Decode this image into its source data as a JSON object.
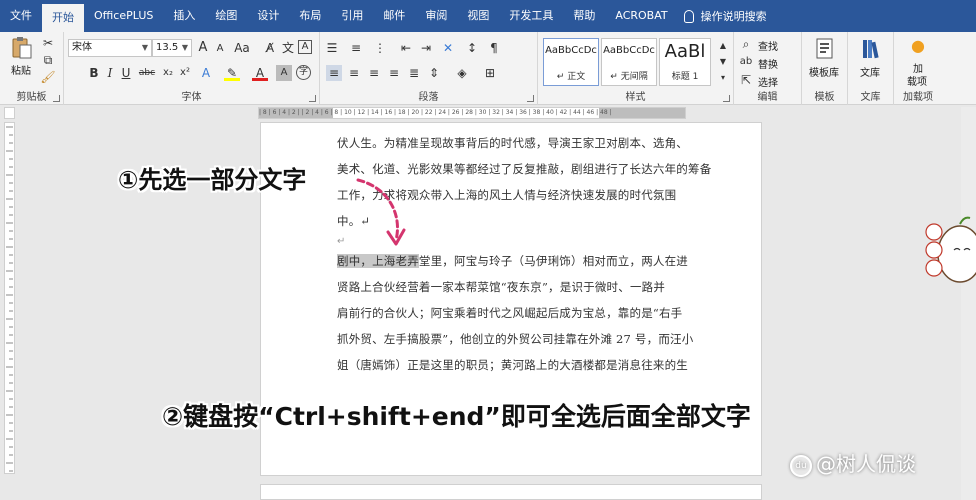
{
  "tabs": [
    "文件",
    "开始",
    "OfficePLUS",
    "插入",
    "绘图",
    "设计",
    "布局",
    "引用",
    "邮件",
    "审阅",
    "视图",
    "开发工具",
    "帮助",
    "ACROBAT"
  ],
  "active_tab_index": 1,
  "tell_me": "操作说明搜索",
  "ribbon": {
    "clipboard": {
      "paste": "粘贴",
      "label": "剪贴板"
    },
    "font": {
      "name": "宋体",
      "size": "13.5",
      "label": "字体",
      "bold": "B",
      "italic": "I",
      "underline": "U",
      "strike": "abc",
      "sub": "x₂",
      "sup": "x²",
      "grow": "A",
      "shrink": "A",
      "case": "Aa"
    },
    "paragraph": {
      "label": "段落"
    },
    "styles": {
      "label": "样式",
      "items": [
        {
          "sample": "AaBbCcDc",
          "name": "↵ 正文"
        },
        {
          "sample": "AaBbCcDc",
          "name": "↵ 无间隔"
        },
        {
          "sample": "AaBl",
          "name": "标题 1"
        }
      ]
    },
    "editing": {
      "find": "查找",
      "replace": "替换",
      "select": "选择",
      "label": "编辑"
    },
    "template": {
      "btn": "模板库",
      "label": "模板"
    },
    "library": {
      "btn": "文库",
      "label": "文库"
    },
    "addins": {
      "btn_line1": "加",
      "btn_line2": "载项",
      "label": "加载项"
    }
  },
  "ruler_marks": "| 8 | 6 | 4 | 2 |  | 2 | 4 | 6 | 8 | 10 | 12 | 14 | 16 | 18 | 20 | 22 | 24 | 26 | 28 | 30 | 32 | 34 | 36 | 38 | 40 | 42 | 44 | 46 | 48 |",
  "document": {
    "lines": [
      "伏人生。为精准呈现故事背后的时代感，导演王家卫对剧本、选角、",
      "美术、化道、光影效果等都经过了反复推敲，剧组进行了长达六年的筹备",
      "工作，力求将观众带入上海的风土人情与经济快速发展的时代氛围",
      "中。↵"
    ],
    "empty_mark": "↵",
    "highlight": "剧中，上海老弄",
    "line_rest": "堂里，阿宝与玲子（马伊琍饰）相对而立，两人在进",
    "lines2": [
      "贤路上合伙经营着一家本帮菜馆“夜东京”，是识于微时、一路并",
      "肩前行的合伙人；阿宝乘着时代之风崛起后成为宝总，靠的是“右手",
      "抓外贸、左手搞股票”，他创立的外贸公司挂靠在外滩 27 号，而汪小",
      "姐（唐嫣饰）正是这里的职员；黄河路上的大酒楼都是消息往来的生"
    ]
  },
  "annotations": {
    "step1": "①先选一部分文字",
    "step2": "②键盘按“Ctrl+shift+end”即可全选后面全部文字"
  },
  "watermark": {
    "logo": "du",
    "text": "@树人侃谈"
  },
  "colors": {
    "accent": "#2b579a",
    "arrow": "#d4356e"
  }
}
